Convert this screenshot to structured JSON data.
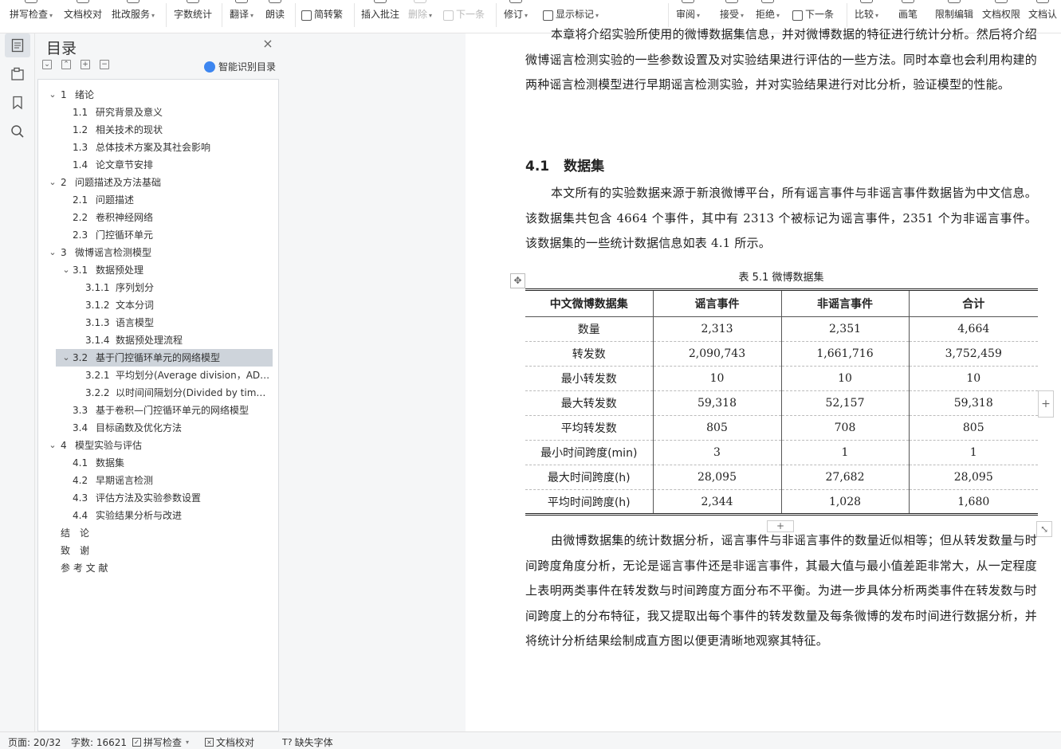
{
  "toolbar": {
    "items": [
      {
        "label": "拼写检查",
        "caret": true
      },
      {
        "label": "文档校对",
        "caret": false
      },
      {
        "label": "批改服务",
        "caret": true
      },
      {
        "label": "字数统计",
        "caret": false
      },
      {
        "label": "翻译",
        "caret": true
      },
      {
        "label": "朗读",
        "caret": false
      },
      {
        "label": "简转繁",
        "caret": false
      },
      {
        "label": "插入批注",
        "caret": false
      },
      {
        "label": "删除",
        "caret": true
      },
      {
        "label": "下一条",
        "caret": false
      },
      {
        "label": "修订",
        "caret": true
      },
      {
        "label": "显示标记",
        "caret": true
      },
      {
        "label": "审阅",
        "caret": true
      },
      {
        "label": "接受",
        "caret": true
      },
      {
        "label": "拒绝",
        "caret": true
      },
      {
        "label": "下一条",
        "caret": false
      },
      {
        "label": "比较",
        "caret": true
      },
      {
        "label": "画笔",
        "caret": false
      },
      {
        "label": "限制编辑",
        "caret": false
      },
      {
        "label": "文档权限",
        "caret": false
      },
      {
        "label": "文档认",
        "caret": false
      }
    ]
  },
  "toc": {
    "title": "目录",
    "smart_label": "智能识别目录",
    "items": [
      {
        "num": "1",
        "text": "绪论",
        "level": 1,
        "expanded": true
      },
      {
        "num": "1.1",
        "text": "研究背景及意义",
        "level": 2
      },
      {
        "num": "1.2",
        "text": "相关技术的现状",
        "level": 2
      },
      {
        "num": "1.3",
        "text": "总体技术方案及其社会影响",
        "level": 2
      },
      {
        "num": "1.4",
        "text": "论文章节安排",
        "level": 2
      },
      {
        "num": "2",
        "text": "问题描述及方法基础",
        "level": 1,
        "expanded": true
      },
      {
        "num": "2.1",
        "text": "问题描述",
        "level": 2
      },
      {
        "num": "2.2",
        "text": "卷积神经网络",
        "level": 2
      },
      {
        "num": "2.3",
        "text": "门控循环单元",
        "level": 2
      },
      {
        "num": "3",
        "text": "微博谣言检测模型",
        "level": 1,
        "expanded": true
      },
      {
        "num": "3.1",
        "text": "数据预处理",
        "level": 2,
        "expanded": true
      },
      {
        "num": "3.1.1",
        "text": "序列划分",
        "level": 3
      },
      {
        "num": "3.1.2",
        "text": "文本分词",
        "level": 3
      },
      {
        "num": "3.1.3",
        "text": "语言模型",
        "level": 3
      },
      {
        "num": "3.1.4",
        "text": "数据预处理流程",
        "level": 3
      },
      {
        "num": "3.2",
        "text": "基于门控循环单元的网络模型",
        "level": 2,
        "expanded": true,
        "selected": true
      },
      {
        "num": "3.2.1",
        "text": "平均划分(Average division，AD…",
        "level": 3
      },
      {
        "num": "3.2.2",
        "text": "以时间间隔划分(Divided by tim…",
        "level": 3
      },
      {
        "num": "3.3",
        "text": "基于卷积—门控循环单元的网络模型",
        "level": 2
      },
      {
        "num": "3.4",
        "text": "目标函数及优化方法",
        "level": 2
      },
      {
        "num": "4",
        "text": "模型实验与评估",
        "level": 1,
        "expanded": true
      },
      {
        "num": "4.1",
        "text": "数据集",
        "level": 2
      },
      {
        "num": "4.2",
        "text": "早期谣言检测",
        "level": 2
      },
      {
        "num": "4.3",
        "text": "评估方法及实验参数设置",
        "level": 2
      },
      {
        "num": "4.4",
        "text": "实验结果分析与改进",
        "level": 2
      },
      {
        "num": "",
        "text": "结　论",
        "level": 1
      },
      {
        "num": "",
        "text": "致　谢",
        "level": 1
      },
      {
        "num": "",
        "text": "参 考 文 献",
        "level": 1
      }
    ]
  },
  "document": {
    "intro": "本章将介绍实验所使用的微博数据集信息，并对微博数据的特征进行统计分析。然后将介绍微博谣言检测实验的一些参数设置及对实验结果进行评估的一些方法。同时本章也会利用构建的两种谣言检测模型进行早期谣言检测实验，并对实验结果进行对比分析，验证模型的性能。",
    "heading_num": "4.1",
    "heading_text": "数据集",
    "para1": "本文所有的实验数据来源于新浪微博平台，所有谣言事件与非谣言事件数据皆为中文信息。该数据集共包含 4664 个事件，其中有 2313 个被标记为谣言事件，2351 个为非谣言事件。该数据集的一些统计数据信息如表 4.1 所示。",
    "table_caption": "表 5.1  微博数据集",
    "table": {
      "headers": [
        "中文微博数据集",
        "谣言事件",
        "非谣言事件",
        "合计"
      ],
      "rows": [
        [
          "数量",
          "2,313",
          "2,351",
          "4,664"
        ],
        [
          "转发数",
          "2,090,743",
          "1,661,716",
          "3,752,459"
        ],
        [
          "最小转发数",
          "10",
          "10",
          "10"
        ],
        [
          "最大转发数",
          "59,318",
          "52,157",
          "59,318"
        ],
        [
          "平均转发数",
          "805",
          "708",
          "805"
        ],
        [
          "最小时间跨度(min)",
          "3",
          "1",
          "1"
        ],
        [
          "最大时间跨度(h)",
          "28,095",
          "27,682",
          "28,095"
        ],
        [
          "平均时间跨度(h)",
          "2,344",
          "1,028",
          "1,680"
        ]
      ]
    },
    "para2": "由微博数据集的统计数据分析，谣言事件与非谣言事件的数量近似相等；但从转发数量与时间跨度角度分析，无论是谣言事件还是非谣言事件，其最大值与最小值差距非常大，从一定程度上表明两类事件在转发数与时间跨度方面分布不平衡。为进一步具体分析两类事件在转发数与时间跨度上的分布特征，我又提取出每个事件的转发数量及每条微博的发布时间进行数据分析，并将统计分析结果绘制成直方图以便更清晰地观察其特征。"
  },
  "status": {
    "page": "页面: 20/32",
    "words": "字数: 16621",
    "spell": "拼写检查",
    "proof": "文档校对",
    "missing_font": "缺失字体"
  },
  "colors": {
    "accent": "#3d86f0",
    "selection": "#ced4db",
    "panel": "#f5f6f7"
  }
}
